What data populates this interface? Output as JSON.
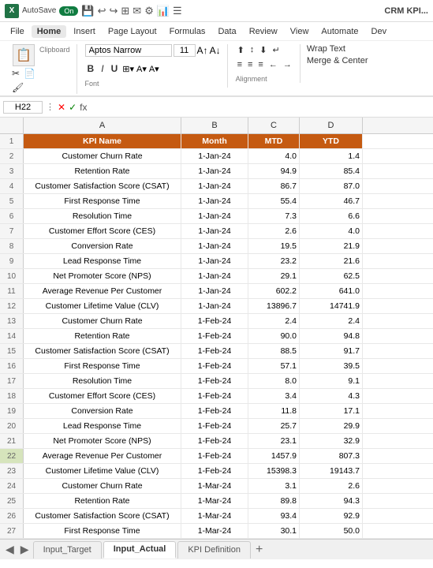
{
  "titleBar": {
    "excelLabel": "X",
    "autosave": "AutoSave",
    "toggleLabel": "On",
    "title": "CRM KPI...",
    "icons": [
      "💾",
      "↩",
      "↪",
      "⊞",
      "✉",
      "⚙",
      "📊",
      "☰"
    ]
  },
  "menuBar": {
    "items": [
      "File",
      "Home",
      "Insert",
      "Page Layout",
      "Formulas",
      "Data",
      "Review",
      "View",
      "Automate",
      "Dev"
    ]
  },
  "ribbon": {
    "clipboard": {
      "label": "Clipboard",
      "pasteLabel": "Paste"
    },
    "font": {
      "label": "Font",
      "family": "Aptos Narrow",
      "size": "11",
      "bold": "B",
      "italic": "I",
      "underline": "U"
    },
    "alignment": {
      "label": "Alignment"
    },
    "wrapText": "Wrap Text",
    "mergeCenter": "Merge & Center"
  },
  "formulaBar": {
    "cellRef": "H22",
    "formula": "fx"
  },
  "columns": {
    "headers": [
      "A",
      "B",
      "C",
      "D"
    ],
    "labels": [
      "KPI Name",
      "Month",
      "MTD",
      "YTD"
    ]
  },
  "rows": [
    {
      "num": "1",
      "a": "KPI Name",
      "b": "Month",
      "c": "MTD",
      "d": "YTD",
      "isHeader": true
    },
    {
      "num": "2",
      "a": "Customer Churn Rate",
      "b": "1-Jan-24",
      "c": "4.0",
      "d": "1.4"
    },
    {
      "num": "3",
      "a": "Retention Rate",
      "b": "1-Jan-24",
      "c": "94.9",
      "d": "85.4"
    },
    {
      "num": "4",
      "a": "Customer Satisfaction Score (CSAT)",
      "b": "1-Jan-24",
      "c": "86.7",
      "d": "87.0"
    },
    {
      "num": "5",
      "a": "First Response Time",
      "b": "1-Jan-24",
      "c": "55.4",
      "d": "46.7"
    },
    {
      "num": "6",
      "a": "Resolution Time",
      "b": "1-Jan-24",
      "c": "7.3",
      "d": "6.6"
    },
    {
      "num": "7",
      "a": "Customer Effort Score (CES)",
      "b": "1-Jan-24",
      "c": "2.6",
      "d": "4.0"
    },
    {
      "num": "8",
      "a": "Conversion Rate",
      "b": "1-Jan-24",
      "c": "19.5",
      "d": "21.9"
    },
    {
      "num": "9",
      "a": "Lead Response Time",
      "b": "1-Jan-24",
      "c": "23.2",
      "d": "21.6"
    },
    {
      "num": "10",
      "a": "Net Promoter Score (NPS)",
      "b": "1-Jan-24",
      "c": "29.1",
      "d": "62.5"
    },
    {
      "num": "11",
      "a": "Average Revenue Per Customer",
      "b": "1-Jan-24",
      "c": "602.2",
      "d": "641.0"
    },
    {
      "num": "12",
      "a": "Customer Lifetime Value (CLV)",
      "b": "1-Jan-24",
      "c": "13896.7",
      "d": "14741.9"
    },
    {
      "num": "13",
      "a": "Customer Churn Rate",
      "b": "1-Feb-24",
      "c": "2.4",
      "d": "2.4"
    },
    {
      "num": "14",
      "a": "Retention Rate",
      "b": "1-Feb-24",
      "c": "90.0",
      "d": "94.8"
    },
    {
      "num": "15",
      "a": "Customer Satisfaction Score (CSAT)",
      "b": "1-Feb-24",
      "c": "88.5",
      "d": "91.7"
    },
    {
      "num": "16",
      "a": "First Response Time",
      "b": "1-Feb-24",
      "c": "57.1",
      "d": "39.5"
    },
    {
      "num": "17",
      "a": "Resolution Time",
      "b": "1-Feb-24",
      "c": "8.0",
      "d": "9.1"
    },
    {
      "num": "18",
      "a": "Customer Effort Score (CES)",
      "b": "1-Feb-24",
      "c": "3.4",
      "d": "4.3"
    },
    {
      "num": "19",
      "a": "Conversion Rate",
      "b": "1-Feb-24",
      "c": "11.8",
      "d": "17.1"
    },
    {
      "num": "20",
      "a": "Lead Response Time",
      "b": "1-Feb-24",
      "c": "25.7",
      "d": "29.9"
    },
    {
      "num": "21",
      "a": "Net Promoter Score (NPS)",
      "b": "1-Feb-24",
      "c": "23.1",
      "d": "32.9"
    },
    {
      "num": "22",
      "a": "Average Revenue Per Customer",
      "b": "1-Feb-24",
      "c": "1457.9",
      "d": "807.3",
      "isSelected": true
    },
    {
      "num": "23",
      "a": "Customer Lifetime Value (CLV)",
      "b": "1-Feb-24",
      "c": "15398.3",
      "d": "19143.7"
    },
    {
      "num": "24",
      "a": "Customer Churn Rate",
      "b": "1-Mar-24",
      "c": "3.1",
      "d": "2.6"
    },
    {
      "num": "25",
      "a": "Retention Rate",
      "b": "1-Mar-24",
      "c": "89.8",
      "d": "94.3"
    },
    {
      "num": "26",
      "a": "Customer Satisfaction Score (CSAT)",
      "b": "1-Mar-24",
      "c": "93.4",
      "d": "92.9"
    },
    {
      "num": "27",
      "a": "First Response Time",
      "b": "1-Mar-24",
      "c": "30.1",
      "d": "50.0"
    }
  ],
  "sheets": {
    "tabs": [
      "Input_Target",
      "Input_Actual",
      "KPI Definition"
    ],
    "activeTab": "Input_Actual",
    "addLabel": "+"
  }
}
